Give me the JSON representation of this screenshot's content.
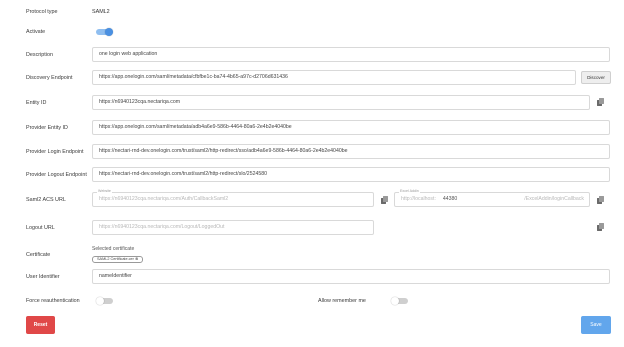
{
  "colors": {
    "accent": "#4a90e2",
    "toggle_on_track": "#8fbef0",
    "toggle_off_track": "#cfcfcf",
    "reset_button": "#e04848",
    "save_button": "#62a6ec"
  },
  "protocol": {
    "label": "Protocol type",
    "value": "SAML2"
  },
  "activate": {
    "label": "Activate",
    "on": true
  },
  "description": {
    "label": "Description",
    "value": "one login web application"
  },
  "discovery": {
    "label": "Discovery Endpoint",
    "value": "https://app.onelogin.com/saml/metadata/cfbfbe1c-ba74-4b65-a97c-d2706d631436",
    "button": "Discover"
  },
  "entity_id": {
    "label": "Entity ID",
    "value": "https://n6940123cqa.nectariqa.com",
    "icon": "copy-icon"
  },
  "provider_entity_id": {
    "label": "Provider Entity ID",
    "value": "https://app.onelogin.com/saml/metadata/adb4a6e9-586b-4464-80a6-2e4b2e4040be"
  },
  "provider_login": {
    "label": "Provider Login Endpoint",
    "value": "https://nectari-rnd-dev.onelogin.com/trust/saml2/http-redirect/sso/adb4a6e9-586b-4464-80a6-2e4b2e4040be"
  },
  "provider_logout": {
    "label": "Provider Logout Endpoint",
    "value": "https://nectari-rnd-dev.onelogin.com/trust/saml2/http-redirect/slo/2524580"
  },
  "acs": {
    "label": "Saml2 ACS URL",
    "website_label": "Website",
    "value": "https://n6940123cqa.nectariqa.com/Auth/CallbackSaml2",
    "excel_label": "Excel Addin",
    "excel_host": "http://localhost:",
    "excel_port": "44380",
    "excel_path": "/ExcelAddin/loginCallback"
  },
  "logout_url": {
    "label": "Logout URL",
    "value": "https://n6940123cqa.nectariqa.com/Logout/LoggedOut"
  },
  "certificate": {
    "label": "Certificate",
    "selected_label": "Selected certificate",
    "chip": "SAML2 Certificate.cer ⊗"
  },
  "user_identifier": {
    "label": "User Identifier",
    "value": "nameIdentifier"
  },
  "force_reauth": {
    "label": "Force reauthentication",
    "on": false
  },
  "allow_remember": {
    "label": "Allow remember me",
    "on": false
  },
  "buttons": {
    "reset": "Reset",
    "save": "Save"
  }
}
